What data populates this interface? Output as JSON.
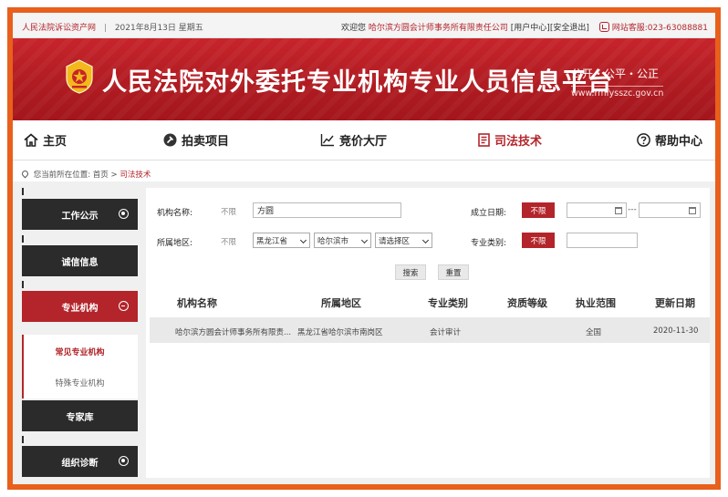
{
  "topbar": {
    "site_name": "人民法院诉讼资产网",
    "separator": "|",
    "date": "2021年8月13日",
    "weekday": "星期五",
    "welcome": "欢迎您",
    "company": "哈尔滨方圆会计师事务所有限责任公司",
    "user_center": "[用户中心]",
    "logout": "[安全退出]",
    "hotline": "网站客服:023-63088881"
  },
  "banner": {
    "title": "人民法院对外委托专业机构专业人员信息平台",
    "motto": "公开・公平・公正",
    "domain": "www.rmfysszc.gov.cn"
  },
  "nav": {
    "items": [
      {
        "label": "主页",
        "icon": "home-icon"
      },
      {
        "label": "拍卖项目",
        "icon": "auction-icon"
      },
      {
        "label": "竞价大厅",
        "icon": "chart-icon"
      },
      {
        "label": "司法技术",
        "icon": "document-icon"
      },
      {
        "label": "帮助中心",
        "icon": "help-icon"
      }
    ],
    "active": "司法技术"
  },
  "breadcrumb": {
    "prefix": "您当前所在位置:",
    "home": "首页",
    "arrow": ">",
    "current": "司法技术"
  },
  "sidebar": {
    "items": [
      {
        "label": "工作公示"
      },
      {
        "label": "诚信信息"
      },
      {
        "label": "专业机构"
      },
      {
        "label": "专家库"
      },
      {
        "label": "组织诊断"
      }
    ],
    "sub_items": [
      {
        "label": "常见专业机构"
      },
      {
        "label": "特殊专业机构"
      }
    ]
  },
  "filter": {
    "org_name_label": "机构名称:",
    "unlimited": "不限",
    "org_name_value": "方圆",
    "established_label": "成立日期:",
    "established_btn": "不限",
    "date_separator": "---",
    "region_label": "所属地区:",
    "province": "黑龙江省",
    "city": "哈尔滨市",
    "district": "请选择区",
    "category_label": "专业类别:",
    "category_btn": "不限",
    "search_btn": "搜索",
    "reset_btn": "重置"
  },
  "table": {
    "headers": [
      "机构名称",
      "所属地区",
      "专业类别",
      "资质等级",
      "执业范围",
      "更新日期"
    ],
    "rows": [
      [
        "哈尔滨方圆会计师事务所有限责...",
        "黑龙江省哈尔滨市南岗区",
        "会计审计",
        "",
        "全国",
        "2020-11-30"
      ]
    ]
  },
  "colors": {
    "brand_red": "#b3252b",
    "frame_orange": "#e8601c",
    "sidebar_dark": "#2b2b2b"
  }
}
